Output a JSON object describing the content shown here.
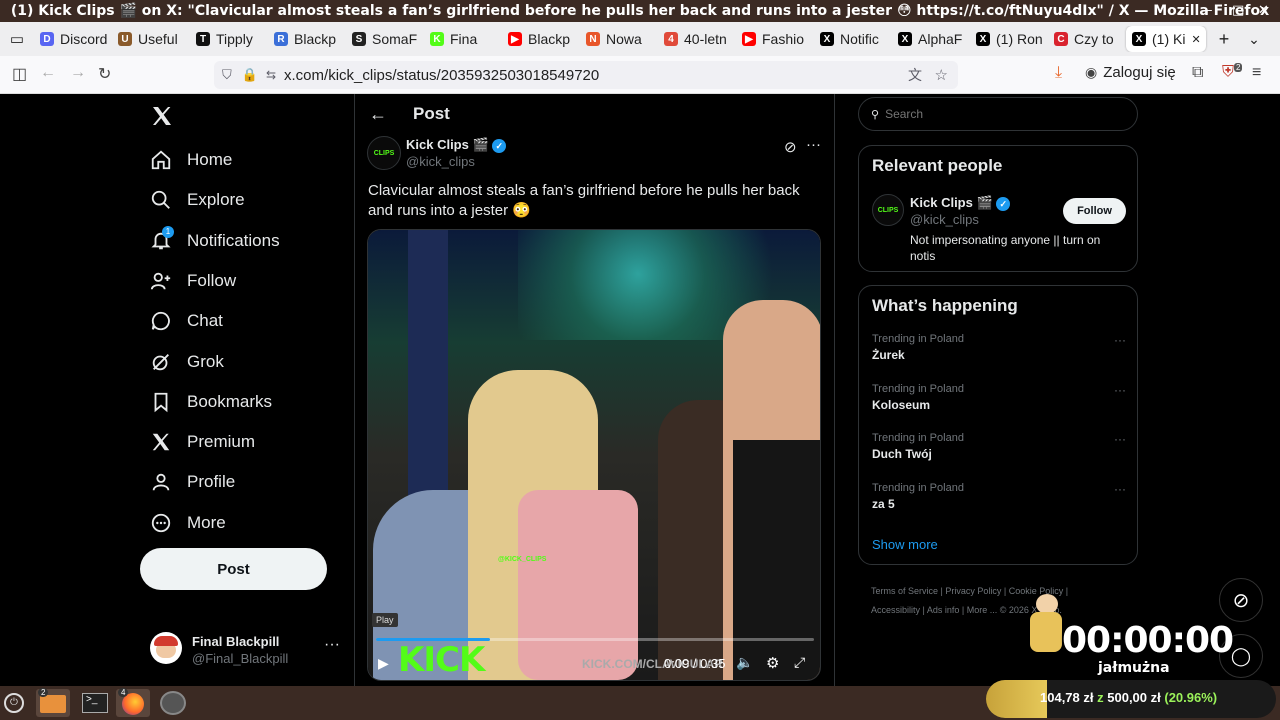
{
  "window": {
    "title": "(1) Kick Clips 🎬 on X: \"Clavicular almost steals a fan’s girlfriend before he pulls her back and runs into a jester 😳 https://t.co/ftNuyu4dIx\" / X — Mozilla Firefox",
    "minimize": "–",
    "maximize": "□",
    "close": "✕"
  },
  "tabs": [
    {
      "label": "Discord",
      "icon_color": "#5865f2",
      "icon_char": "D"
    },
    {
      "label": "Useful",
      "icon_color": "#8a5a2b",
      "icon_char": "U"
    },
    {
      "label": "Tipply",
      "icon_color": "#111111",
      "icon_char": "T"
    },
    {
      "label": "Blackp",
      "icon_color": "#3b6fd8",
      "icon_char": "R"
    },
    {
      "label": "SomaF",
      "icon_color": "#222222",
      "icon_char": "S"
    },
    {
      "label": "Fina",
      "icon_color": "#53fc18",
      "icon_char": "K"
    },
    {
      "label": "Blackp",
      "icon_color": "#ff0000",
      "icon_char": "▶"
    },
    {
      "label": "Nowa",
      "icon_color": "#e8562a",
      "icon_char": "N"
    },
    {
      "label": "40-letn",
      "icon_color": "#e04a3a",
      "icon_char": "4"
    },
    {
      "label": "Fashio",
      "icon_color": "#ff0000",
      "icon_char": "▶"
    },
    {
      "label": "Notific",
      "icon_color": "#000000",
      "icon_char": "X"
    },
    {
      "label": "AlphaF",
      "icon_color": "#000000",
      "icon_char": "X"
    },
    {
      "label": "(1) Ron",
      "icon_color": "#000000",
      "icon_char": "X"
    },
    {
      "label": "Czy to",
      "icon_color": "#d9232e",
      "icon_char": "C"
    },
    {
      "label": "(1) Ki",
      "icon_color": "#000000",
      "icon_char": "X",
      "active": true
    }
  ],
  "tabbar": {
    "new_tab": "+",
    "list_all": "⌄",
    "close_tab": "✕"
  },
  "urlbar": {
    "url": "x.com/kick_clips/status/2035932503018549720"
  },
  "toolbar": {
    "login_label": "Zaloguj się",
    "ext_badge": "2"
  },
  "sidebar": {
    "items": [
      {
        "label": "Home",
        "icon": "home-icon"
      },
      {
        "label": "Explore",
        "icon": "search-icon"
      },
      {
        "label": "Notifications",
        "icon": "bell-icon",
        "badge": "1"
      },
      {
        "label": "Follow",
        "icon": "person-plus-icon"
      },
      {
        "label": "Chat",
        "icon": "chat-icon"
      },
      {
        "label": "Grok",
        "icon": "grok-icon"
      },
      {
        "label": "Bookmarks",
        "icon": "bookmark-icon"
      },
      {
        "label": "Premium",
        "icon": "x-icon"
      },
      {
        "label": "Profile",
        "icon": "person-icon"
      },
      {
        "label": "More",
        "icon": "more-icon"
      }
    ],
    "post_label": "Post",
    "account": {
      "name": "Final Blackpill",
      "handle": "@Final_Blackpill"
    }
  },
  "post": {
    "header": "Post",
    "author": "Kick Clips 🎬",
    "handle": "@kick_clips",
    "text": "Clavicular almost steals a fan’s girlfriend before he pulls her back and runs into a jester 😳",
    "video": {
      "tooltip": "Play",
      "time": "0:09 / 0:35",
      "watermark": "KICK",
      "watermark_url": "KICK.COM/CLAVICULAR",
      "tag": "@KICK_CLIPS",
      "progress": 0.26
    }
  },
  "search": {
    "placeholder": "Search"
  },
  "relevant": {
    "title": "Relevant people",
    "name": "Kick Clips 🎬",
    "handle": "@kick_clips",
    "bio": "Not impersonating anyone || turn on notis",
    "follow_label": "Follow"
  },
  "happening": {
    "title": "What’s happening",
    "trends": [
      {
        "context": "Trending in Poland",
        "name": "Żurek"
      },
      {
        "context": "Trending in Poland",
        "name": "Koloseum"
      },
      {
        "context": "Trending in Poland",
        "name": "Duch Twój"
      },
      {
        "context": "Trending in Poland",
        "name": "za 5"
      }
    ],
    "show_more": "Show more"
  },
  "footer": {
    "links": [
      "Terms of Service",
      "Privacy Policy",
      "Cookie Policy",
      "Accessibility",
      "Ads info",
      "More ..."
    ],
    "copyright": "© 2026 X Corp."
  },
  "stream_overlay": {
    "timer": "00:00:00",
    "label": "jałmużna",
    "goal_text": "104,78 zł",
    "goal_sep": "z",
    "goal_total": "500,00 zł",
    "goal_pct_label": "(20.96%)",
    "goal_fraction": 0.2096
  },
  "taskbar": {
    "files_badge": "2",
    "firefox_badge": "4"
  },
  "colors": {
    "accent": "#1d9bf0",
    "kick_green": "#53fc18",
    "goal_green": "#9bf25a"
  }
}
